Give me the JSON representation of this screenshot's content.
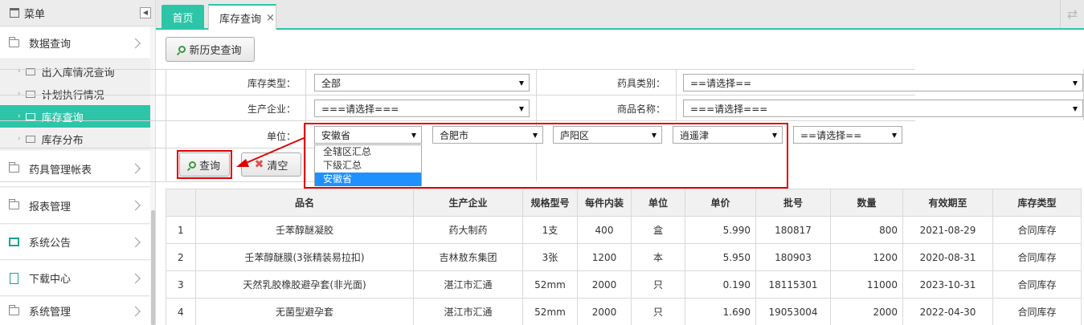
{
  "sidebar": {
    "title": "菜单",
    "collapse_glyph": "◀",
    "groups": [
      {
        "label": "数据查询"
      },
      {
        "label": "药具管理帐表"
      },
      {
        "label": "报表管理"
      },
      {
        "label": "系统公告"
      },
      {
        "label": "下载中心"
      },
      {
        "label": "系统管理"
      }
    ],
    "sub_items": [
      {
        "label": "出入库情况查询"
      },
      {
        "label": "计划执行情况"
      },
      {
        "label": "库存查询"
      },
      {
        "label": "库存分布"
      }
    ]
  },
  "tabs": {
    "home": "首页",
    "current": "库存查询",
    "close": "×",
    "refresh": "⇄"
  },
  "toolbar": {
    "history_query": "新历史查询"
  },
  "form": {
    "inventory_type_label": "库存类型：",
    "inventory_type_value": "全部",
    "category_label": "药具类别：",
    "category_value": "==请选择==",
    "manufacturer_label": "生产企业：",
    "manufacturer_value": "===请选择===",
    "product_label": "商品名称：",
    "product_value": "===请选择===",
    "unit_label": "单位：",
    "unit_province": "安徽省",
    "unit_city": "合肥市",
    "unit_district": "庐阳区",
    "unit_town": "逍遥津",
    "unit_extra": "==请选择==",
    "dropdown_options": [
      "全辖区汇总",
      "下级汇总",
      "安徽省"
    ],
    "query_button": "查询",
    "clear_button": "清空",
    "clear_icon": "✖"
  },
  "table": {
    "headers": [
      "",
      "品名",
      "生产企业",
      "规格型号",
      "每件内装",
      "单位",
      "单价",
      "批号",
      "数量",
      "有效期至",
      "库存类型"
    ],
    "rows": [
      [
        "1",
        "壬苯醇醚凝胶",
        "药大制药",
        "1支",
        "400",
        "盒",
        "5.990",
        "180817",
        "800",
        "2021-08-29",
        "合同库存"
      ],
      [
        "2",
        "壬苯醇醚膜(3张精装易拉扣)",
        "吉林敖东集团",
        "3张",
        "1200",
        "本",
        "5.950",
        "180903",
        "1200",
        "2020-08-31",
        "合同库存"
      ],
      [
        "3",
        "天然乳胶橡胶避孕套(非光面)",
        "湛江市汇通",
        "52mm",
        "2000",
        "只",
        "0.190",
        "18115301",
        "11000",
        "2023-10-31",
        "合同库存"
      ],
      [
        "4",
        "无菌型避孕套",
        "湛江市汇通",
        "52mm",
        "2000",
        "只",
        "1.690",
        "19053004",
        "2000",
        "2022-04-30",
        "合同库存"
      ]
    ]
  }
}
